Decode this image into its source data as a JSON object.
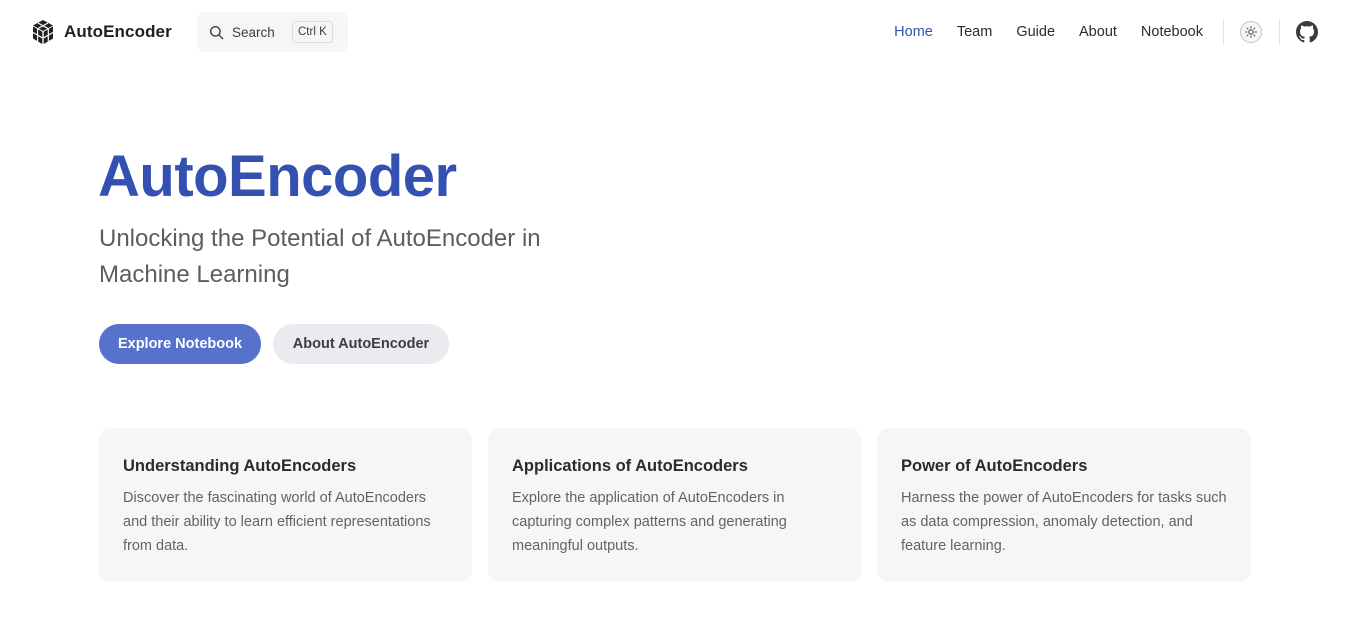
{
  "nav": {
    "brand": "AutoEncoder",
    "search": {
      "label": "Search",
      "shortcut": "Ctrl K"
    },
    "links": [
      {
        "label": "Home",
        "active": true
      },
      {
        "label": "Team",
        "active": false
      },
      {
        "label": "Guide",
        "active": false
      },
      {
        "label": "About",
        "active": false
      },
      {
        "label": "Notebook",
        "active": false
      }
    ],
    "icons": [
      "logo-cube-icon",
      "search-icon",
      "sun-icon",
      "github-icon"
    ]
  },
  "hero": {
    "name": "AutoEncoder",
    "tagline": "Unlocking the Potential of AutoEncoder in Machine Learning",
    "actions": [
      {
        "label": "Explore Notebook",
        "theme": "brand"
      },
      {
        "label": "About AutoEncoder",
        "theme": "alt"
      }
    ]
  },
  "features": [
    {
      "title": "Understanding AutoEncoders",
      "details": "Discover the fascinating world of AutoEncoders and their ability to learn efficient representations from data."
    },
    {
      "title": "Applications of AutoEncoders",
      "details": "Explore the application of AutoEncoders in capturing complex patterns and generating meaningful outputs."
    },
    {
      "title": "Power of AutoEncoders",
      "details": "Harness the power of AutoEncoders for tasks such as data compression, anomaly detection, and feature learning."
    }
  ],
  "colors": {
    "brand": "#3451b2",
    "button_brand_bg": "#5672cd",
    "button_alt_bg": "#ebebef",
    "card_bg": "#f6f6f7"
  }
}
